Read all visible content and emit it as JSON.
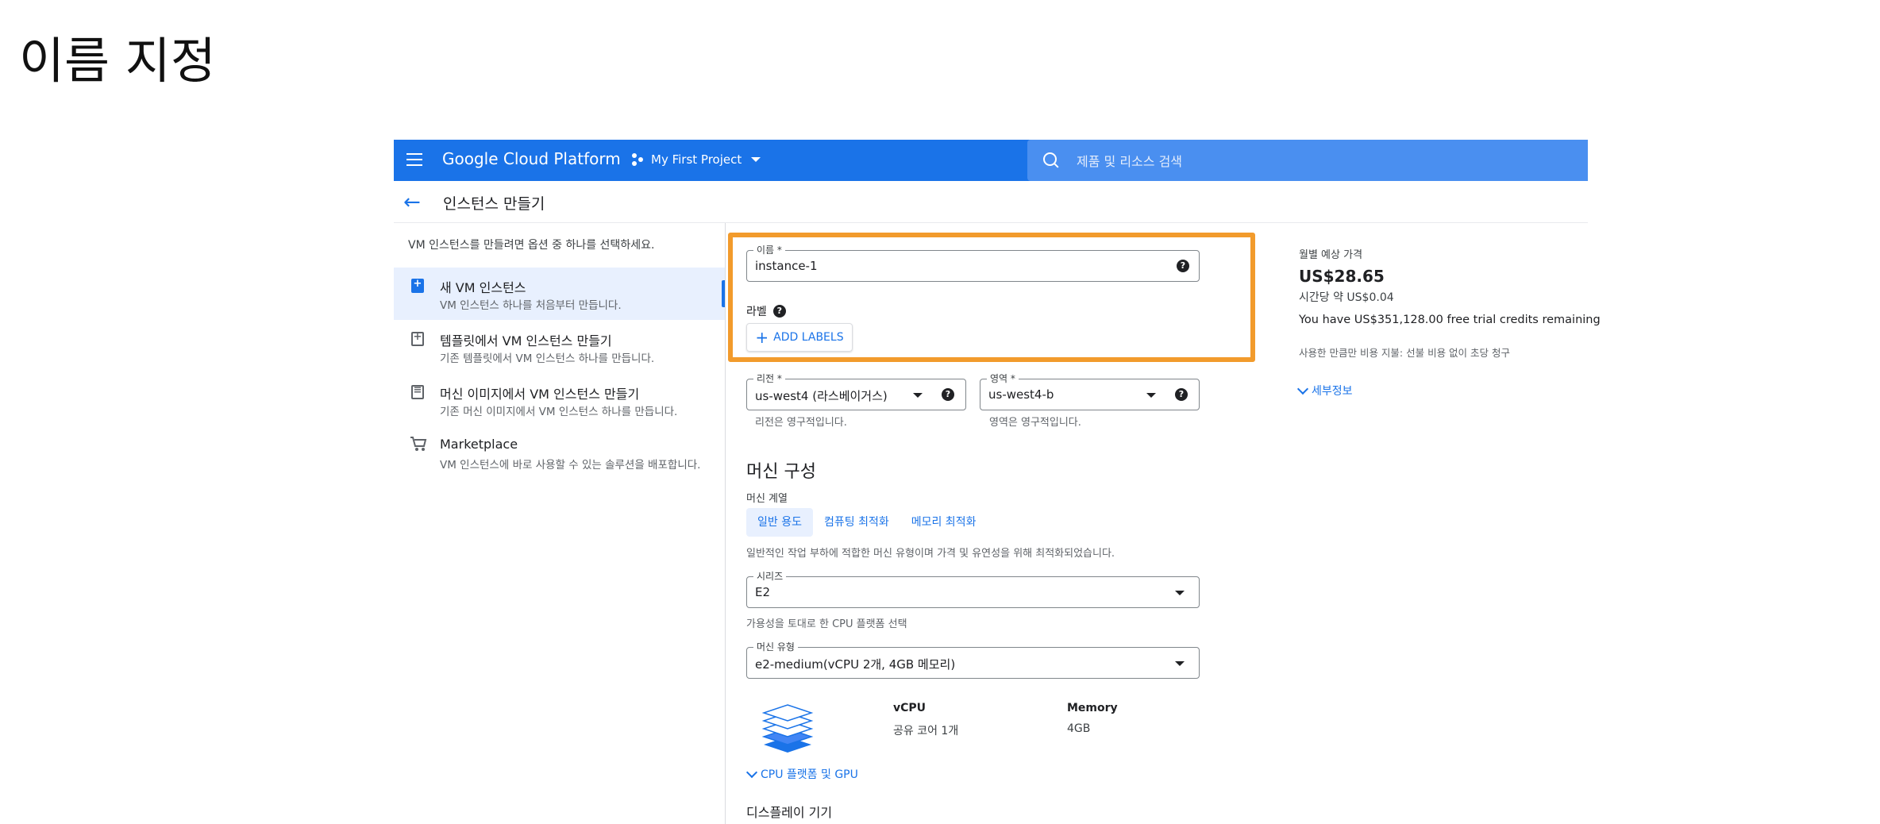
{
  "slide": {
    "title": "이름 지정"
  },
  "topbar": {
    "brand": "Google Cloud Platform",
    "project": "My First Project",
    "search_placeholder": "제품 및 리소스 검색"
  },
  "subheader": {
    "back": "←",
    "title": "인스턴스 만들기"
  },
  "left": {
    "intro": "VM 인스턴스를 만들려면 옵션 중 하나를 선택하세요.",
    "options": [
      {
        "title": "새 VM 인스턴스",
        "sub": "VM 인스턴스 하나를 처음부터 만듭니다.",
        "icon": "+"
      },
      {
        "title": "템플릿에서 VM 인스턴스 만들기",
        "sub": "기존 템플릿에서 VM 인스턴스 하나를 만듭니다.",
        "icon": "+"
      },
      {
        "title": "머신 이미지에서 VM 인스턴스 만들기",
        "sub": "기존 머신 이미지에서 VM 인스턴스 하나를 만듭니다.",
        "icon": "≡"
      },
      {
        "title": "Marketplace",
        "sub": "VM 인스턴스에 바로 사용할 수 있는 솔루션을 배포합니다.",
        "icon": "cart"
      }
    ]
  },
  "form": {
    "name_label": "이름 *",
    "name_value": "instance-1",
    "labels_label": "라벨",
    "add_labels": "ADD LABELS",
    "region_label": "리전 *",
    "region_value": "us-west4 (라스베이거스)",
    "region_hint": "리전은 영구적입니다.",
    "zone_label": "영역 *",
    "zone_value": "us-west4-b",
    "zone_hint": "영역은 영구적입니다.",
    "help": "?"
  },
  "machine": {
    "section_title": "머신 구성",
    "family_label": "머신 계열",
    "chips": [
      "일반 용도",
      "컴퓨팅 최적화",
      "메모리 최적화"
    ],
    "selected_chip": "일반 용도",
    "family_desc": "일반적인 작업 부하에 적합한 머신 유형이며 가격 및 유연성을 위해 최적화되었습니다.",
    "series_label": "시리즈",
    "series_value": "E2",
    "series_hint": "가용성을 토대로 한 CPU 플랫폼 선택",
    "type_label": "머신 유형",
    "type_value": "e2-medium(vCPU 2개, 4GB 메모리)",
    "vcpu_h": "vCPU",
    "vcpu_v": "공유 코어 1개",
    "mem_h": "Memory",
    "mem_v": "4GB",
    "cpu_gpu": "CPU 플랫폼 및 GPU",
    "display_device": "디스플레이 기기"
  },
  "pricing": {
    "header": "월별 예상 가격",
    "monthly": "US$28.65",
    "hourly": "시간당 약 US$0.04",
    "trial": "You have US$351,128.00 free trial credits remaining",
    "billing": "사용한 만큼만 비용 지불: 선불 비용 없이 초당 청구",
    "details": "세부정보"
  },
  "colors": {
    "accent": "#1a73e8",
    "highlight": "#f29b2c"
  }
}
